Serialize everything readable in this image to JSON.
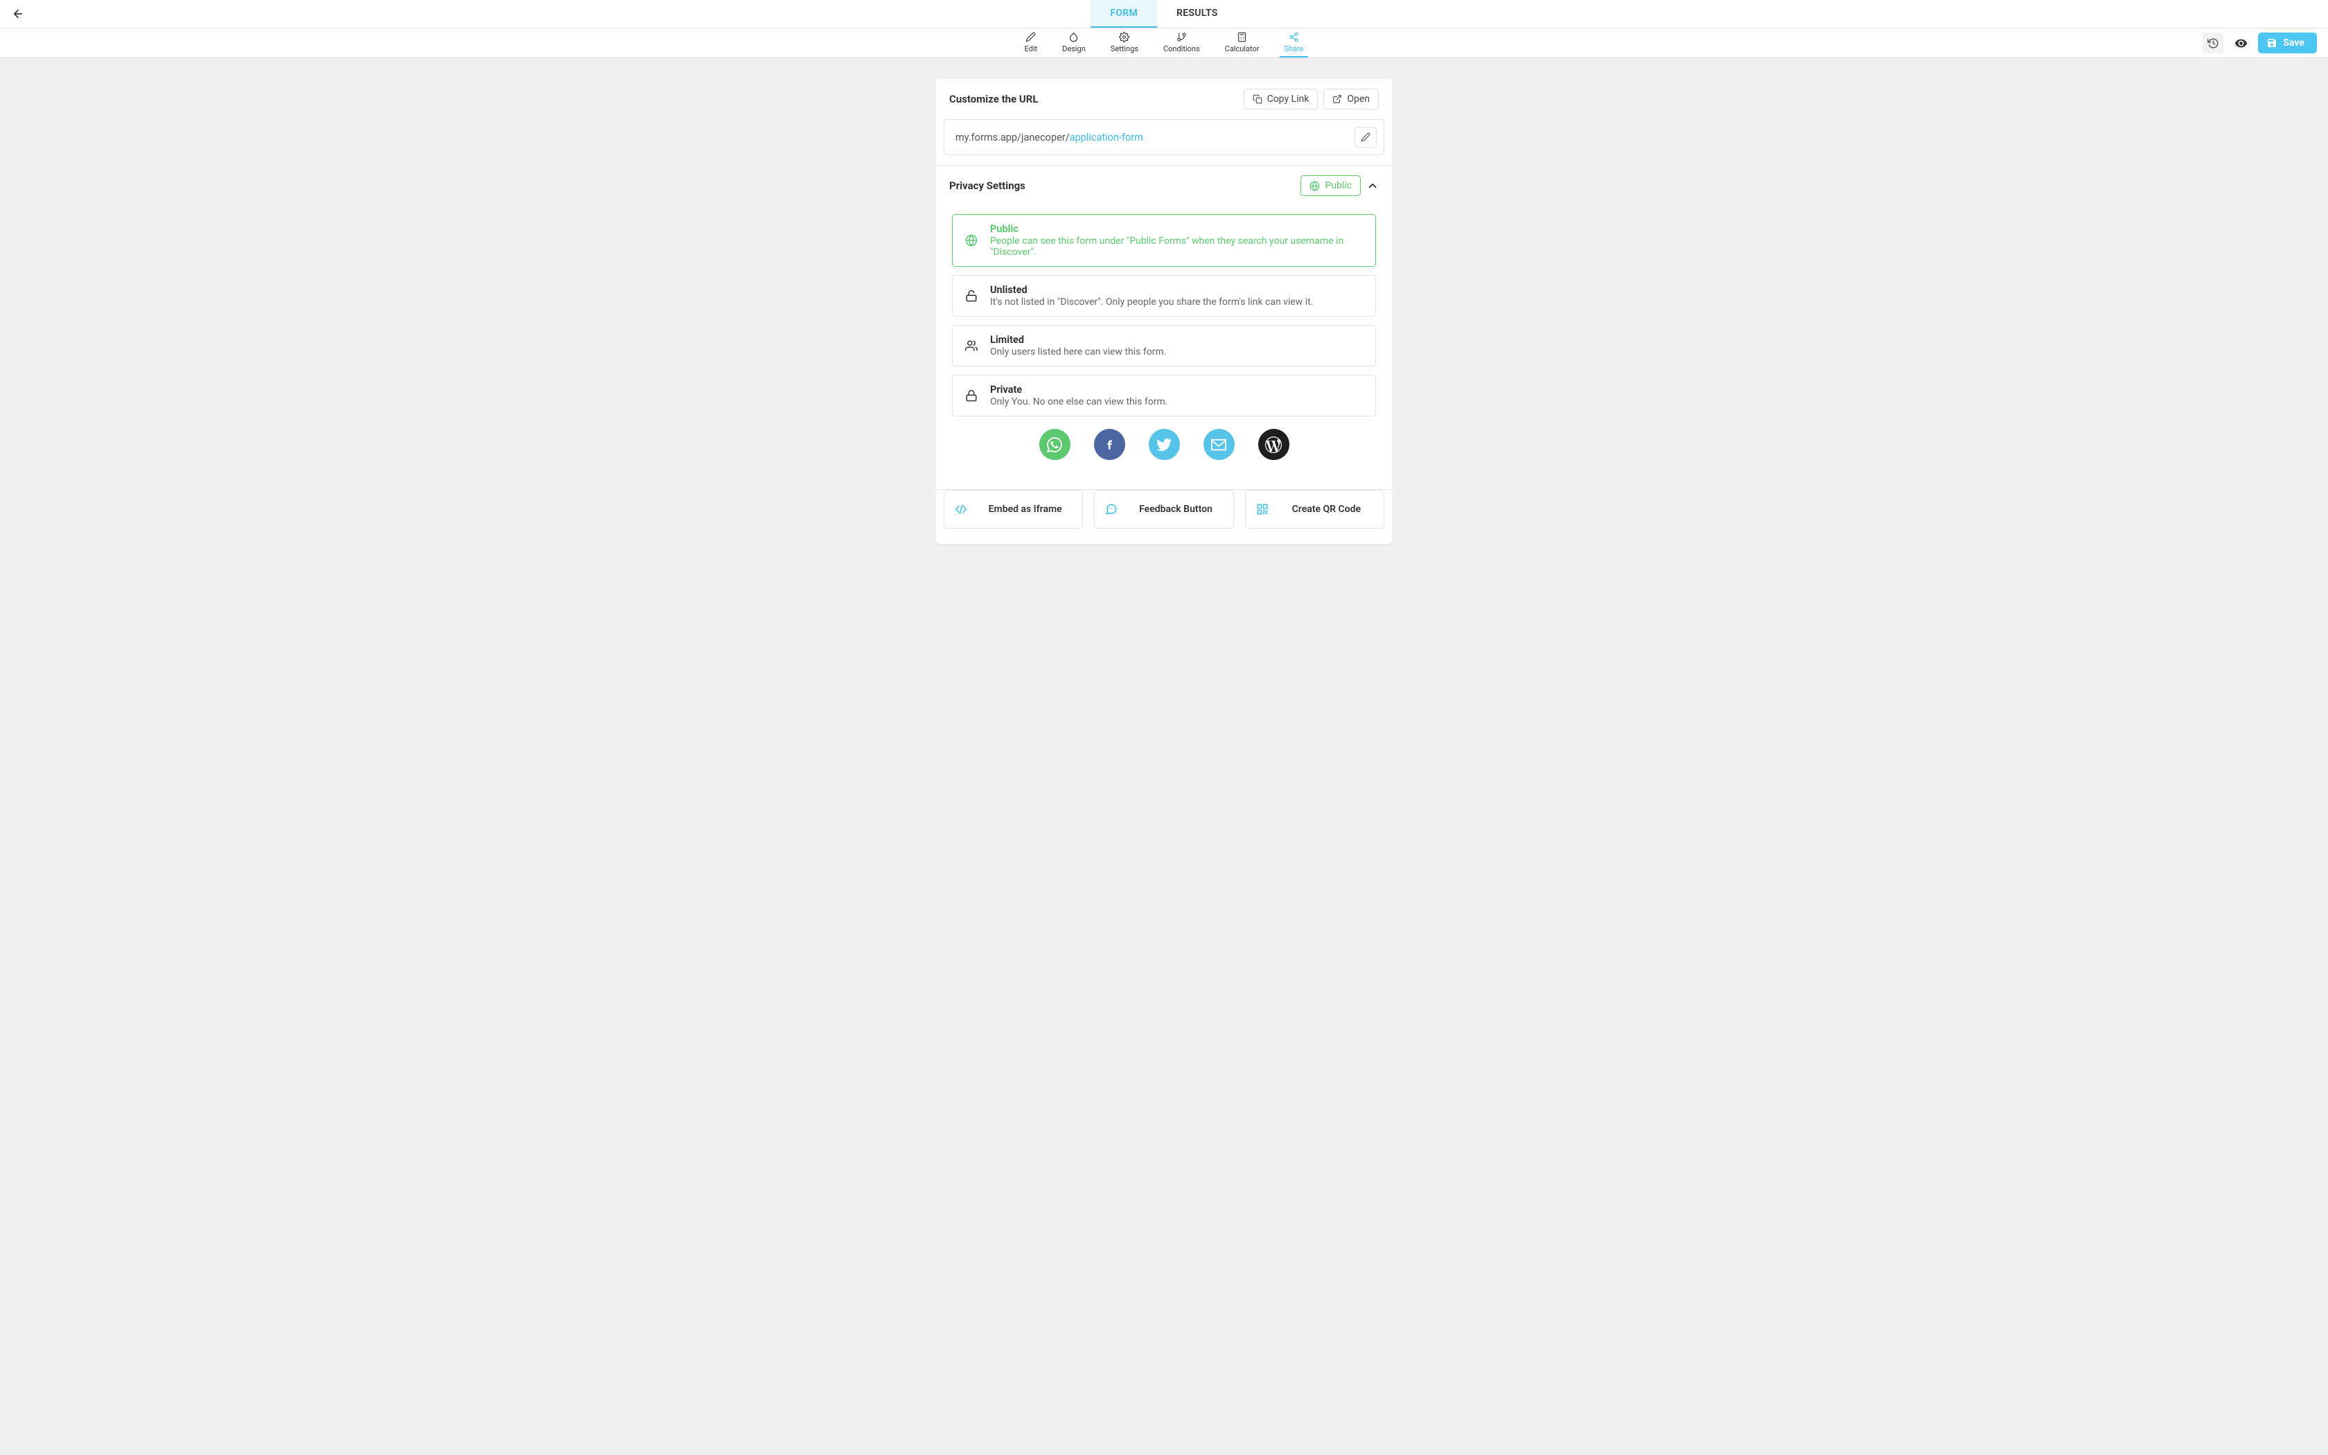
{
  "top_tabs": {
    "form": "FORM",
    "results": "RESULTS"
  },
  "toolbar": {
    "edit": "Edit",
    "design": "Design",
    "settings": "Settings",
    "conditions": "Conditions",
    "calculator": "Calculator",
    "share": "Share",
    "save": "Save"
  },
  "url_section": {
    "title": "Customize the URL",
    "copy": "Copy Link",
    "open": "Open",
    "base": "my.forms.app/janecoper/",
    "slug": "application-form"
  },
  "privacy": {
    "title": "Privacy Settings",
    "badge": "Public",
    "options": [
      {
        "title": "Public",
        "desc": "People can see this form under \"Public Forms\" when they search your username in \"Discover\"."
      },
      {
        "title": "Unlisted",
        "desc": "It's not listed in \"Discover\". Only people you share the form's link can view it."
      },
      {
        "title": "Limited",
        "desc": "Only users listed here can view this form."
      },
      {
        "title": "Private",
        "desc": "Only You. No one else can view this form."
      }
    ]
  },
  "social": {
    "whatsapp_color": "#5cc96f",
    "facebook_color": "#4b66a0",
    "twitter_color": "#56c3e8",
    "email_color": "#56c3e8",
    "wordpress_color": "#1e1e1e"
  },
  "bottom_cards": {
    "embed": "Embed as Iframe",
    "feedback": "Feedback Button",
    "qr": "Create QR Code"
  }
}
